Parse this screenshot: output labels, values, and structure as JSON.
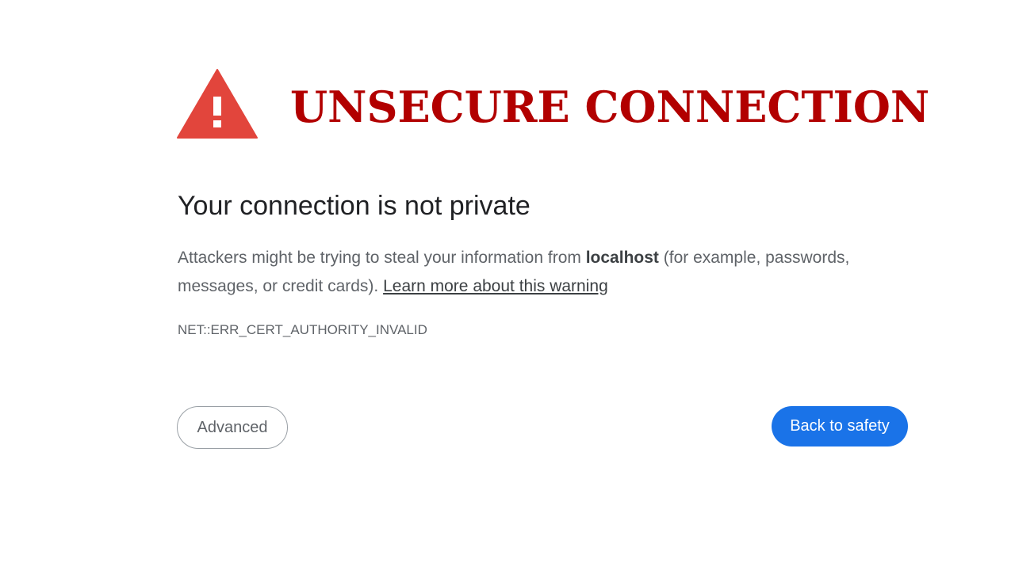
{
  "banner": {
    "title": "UNSECURE CONNECTION",
    "icon": "warning-triangle-icon",
    "title_color": "#b20000",
    "icon_color": "#e2453c"
  },
  "interstitial": {
    "heading": "Your connection is not private",
    "body_before": "Attackers might be trying to steal your information from ",
    "host": "localhost",
    "body_after": " (for example, passwords, messages, or credit cards). ",
    "learn_more_link": "Learn more about this warning",
    "error_code": "NET::ERR_CERT_AUTHORITY_INVALID"
  },
  "buttons": {
    "advanced_label": "Advanced",
    "back_label": "Back to safety",
    "primary_color": "#1a73e8"
  }
}
